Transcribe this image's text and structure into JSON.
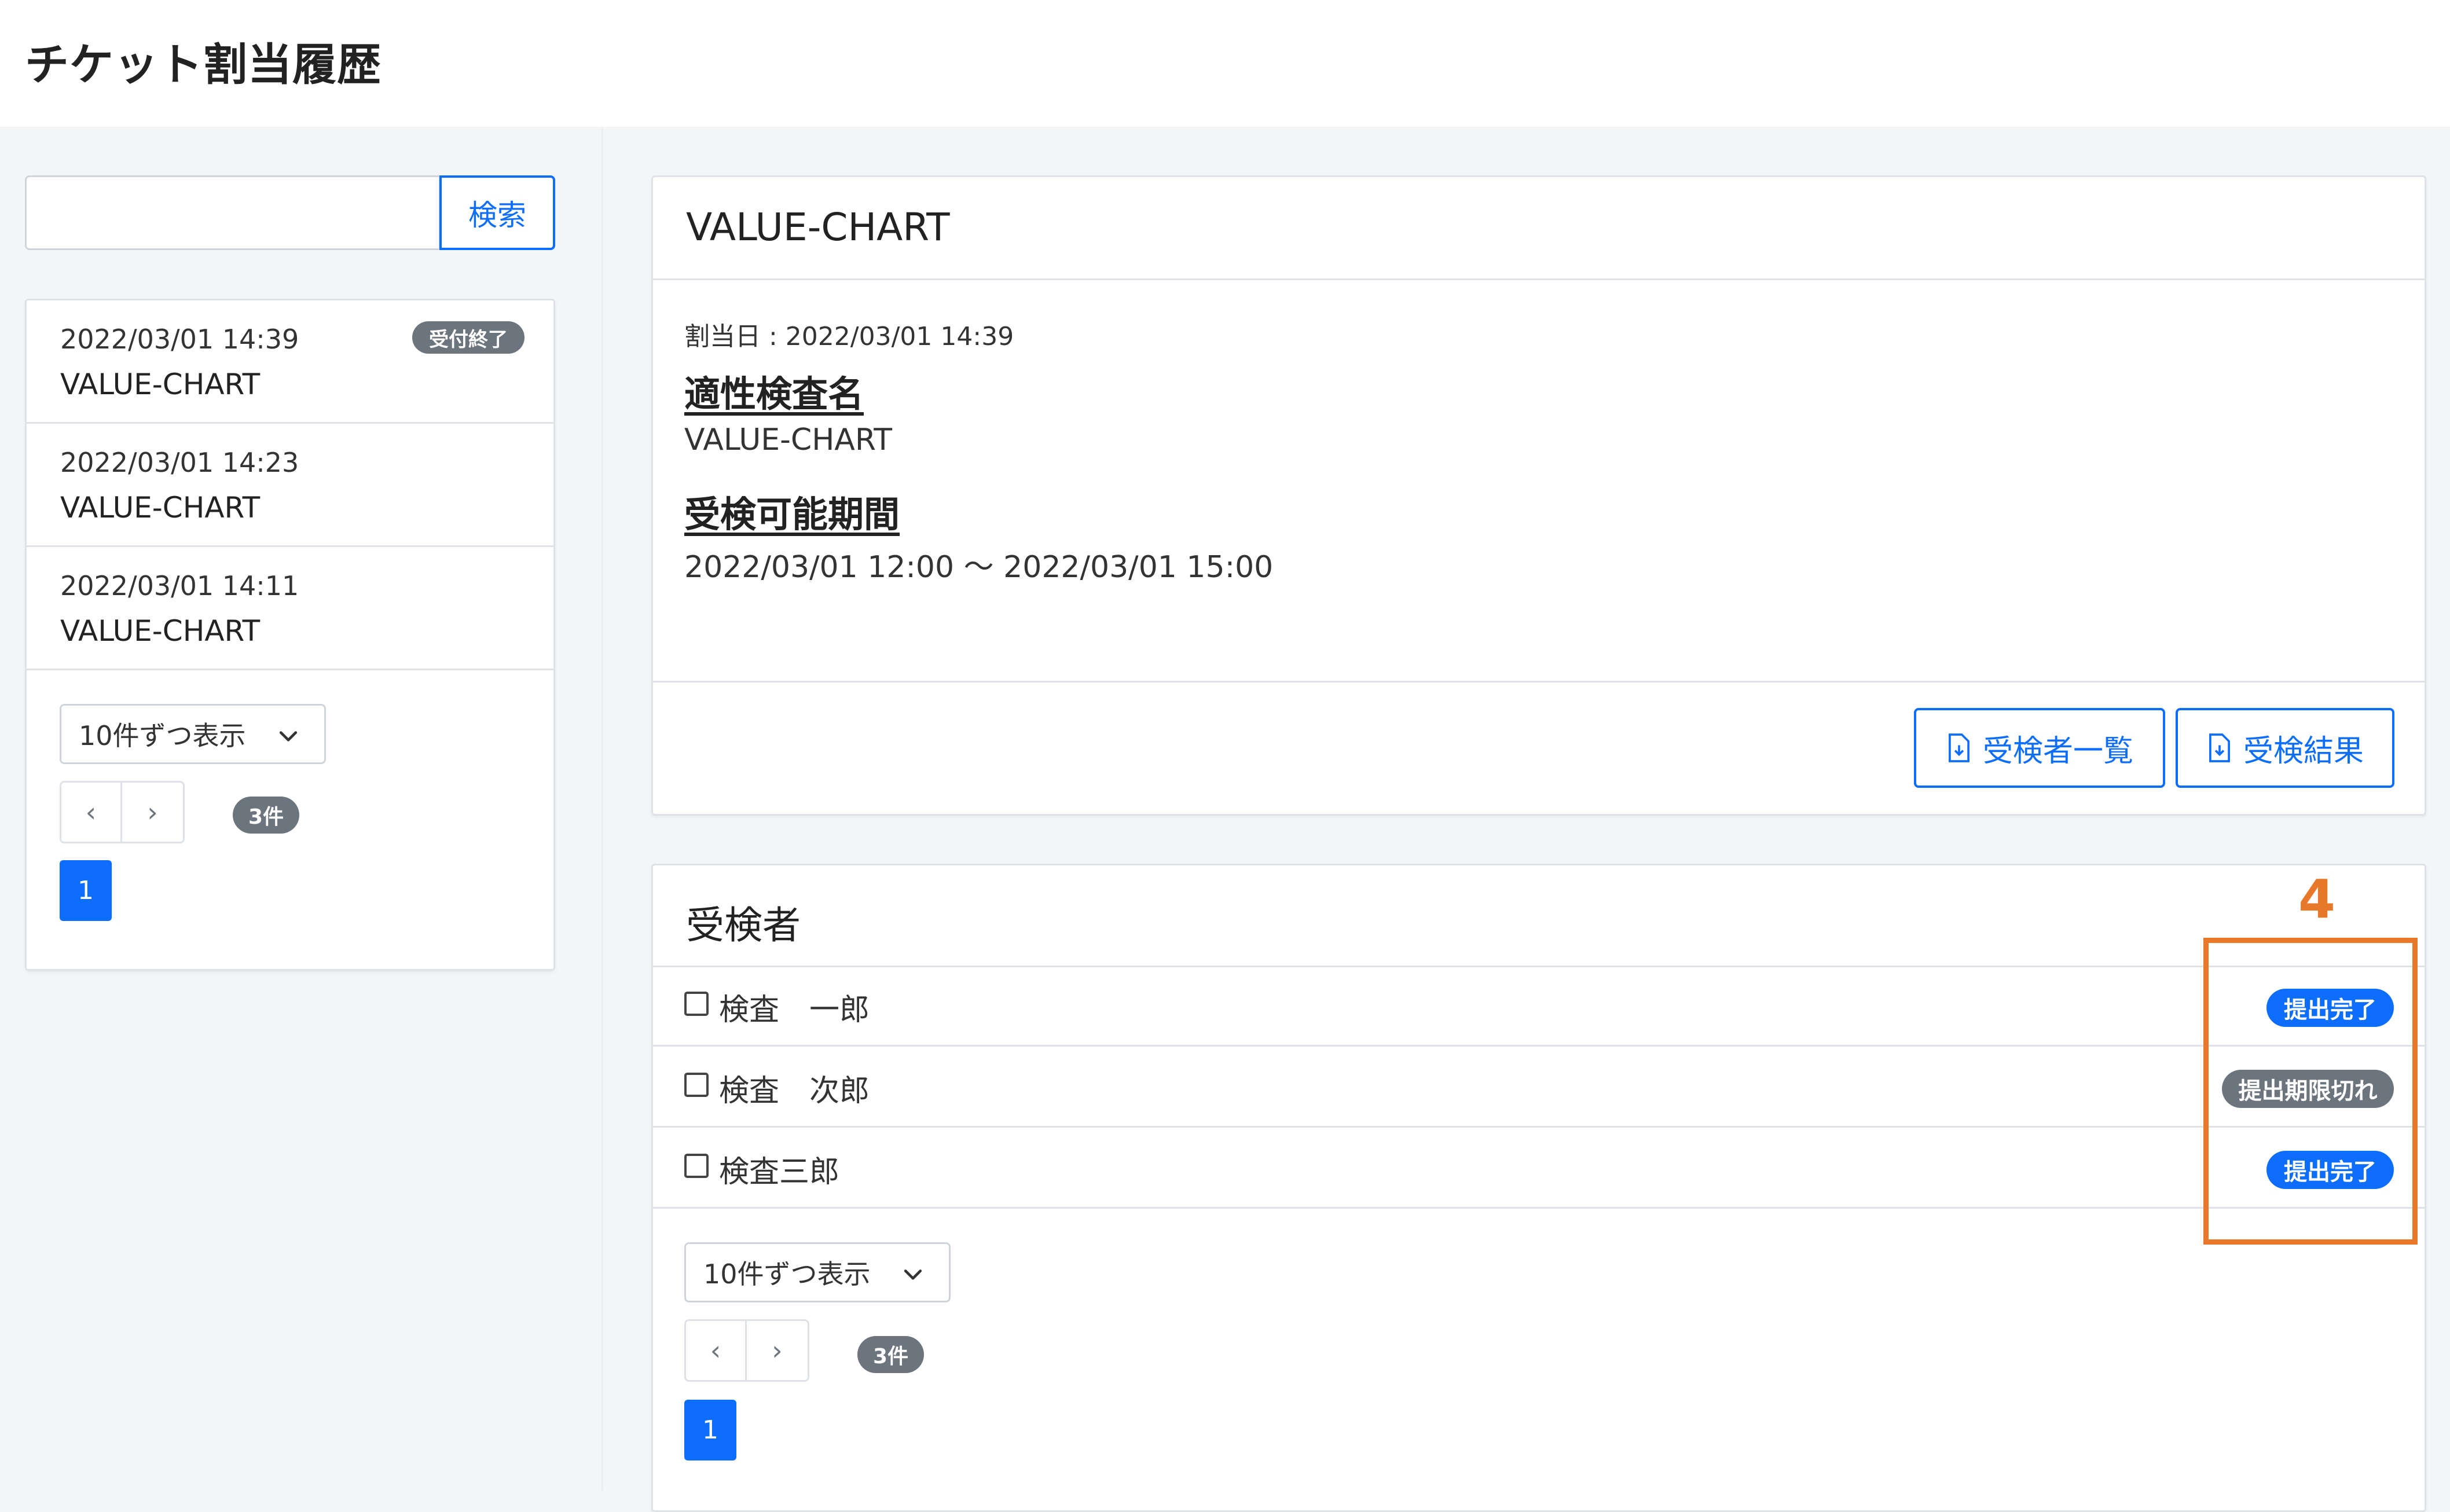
{
  "page": {
    "title": "チケット割当履歴"
  },
  "search": {
    "placeholder": "",
    "button_label": "検索"
  },
  "history": {
    "items": [
      {
        "date": "2022/03/01 14:39",
        "name": "VALUE-CHART",
        "badge": "受付終了"
      },
      {
        "date": "2022/03/01 14:23",
        "name": "VALUE-CHART",
        "badge": ""
      },
      {
        "date": "2022/03/01 14:11",
        "name": "VALUE-CHART",
        "badge": ""
      }
    ],
    "page_size_label": "10件ずつ表示",
    "prev": "‹",
    "next": "›",
    "count_badge": "3件",
    "current_page": "1"
  },
  "detail": {
    "title": "VALUE-CHART",
    "assigned_date": "割当日 : 2022/03/01 14:39",
    "exam_name_label": "適性検査名",
    "exam_name": "VALUE-CHART",
    "period_label": "受検可能期間",
    "period": "2022/03/01 12:00 〜 2022/03/01 15:00",
    "examinee_list_button": "受検者一覧",
    "result_button": "受検結果"
  },
  "examinees": {
    "title": "受検者",
    "rows": [
      {
        "name": "検査　一郎",
        "status": "提出完了"
      },
      {
        "name": "検査　次郎",
        "status": "提出期限切れ"
      },
      {
        "name": "検査三郎",
        "status": "提出完了"
      }
    ],
    "page_size_label": "10件ずつ表示",
    "prev": "‹",
    "next": "›",
    "count_badge": "3件",
    "current_page": "1"
  },
  "annotation": {
    "number": "4"
  },
  "colors": {
    "primary": "#0d6efd",
    "badge_gray": "#6c757d",
    "annotation": "#e8792b"
  },
  "icons": {
    "select": "chevron-down-icon",
    "download": "file-download-icon"
  }
}
